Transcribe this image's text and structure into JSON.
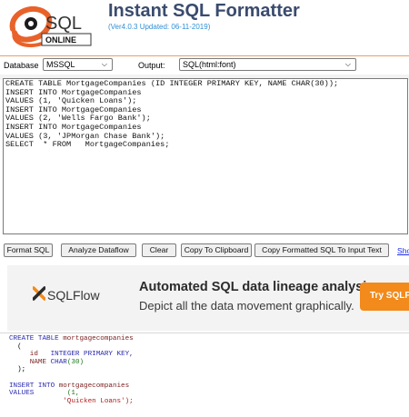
{
  "header": {
    "logo_sql": "SQL",
    "logo_online": "ONLINE",
    "title": "Instant SQL Formatter",
    "version": "(Ver4.0.3 Updated: 06-11-2019)"
  },
  "options": {
    "database_label": "Database",
    "database_value": "MSSQL",
    "output_label": "Output:",
    "output_value": "SQL(html:font)"
  },
  "editor": {
    "lines": [
      "CREATE TABLE MortgageCompanies (ID INTEGER PRIMARY KEY, NAME CHAR(30));",
      "INSERT INTO MortgageCompanies",
      "VALUES (1, 'Quicken Loans');",
      "INSERT INTO MortgageCompanies",
      "VALUES (2, 'Wells Fargo Bank');",
      "INSERT INTO MortgageCompanies",
      "VALUES (3, 'JPMorgan Chase Bank');",
      "SELECT  * FROM   MortgageCompanies;"
    ]
  },
  "toolbar": {
    "format_sql": "Format SQL",
    "analyze_dataflow": "Analyze Dataflow",
    "clear": "Clear",
    "copy_clipboard": "Copy To Clipboard",
    "copy_formatted": "Copy Formatted SQL To Input Text",
    "show_link": "Sho"
  },
  "banner": {
    "sqlflow": "SQLFlow",
    "title": "Automated SQL data lineage analysis.",
    "subtitle": "Depict all the data movement graphically.",
    "try_button": "Try SQLF"
  },
  "output": {
    "create": "CREATE TABLE",
    "table": "mortgagecompanies",
    "open_paren": "(",
    "col1": "id",
    "col1_type": "INTEGER PRIMARY KEY,",
    "col2": "NAME",
    "col2_type": "CHAR",
    "col2_len": "(30)",
    "close": ");",
    "insert": "INSERT INTO",
    "insert_table": "mortgagecompanies",
    "values": "VALUES",
    "val1": "(1,",
    "val1_str": "'Quicken Loans');"
  },
  "colors": {
    "title": "#3a4b6e",
    "version": "#2f8fd4",
    "try_button": "#f28a1c",
    "link": "#1b2aee",
    "keyword": "#2a2ab0"
  }
}
